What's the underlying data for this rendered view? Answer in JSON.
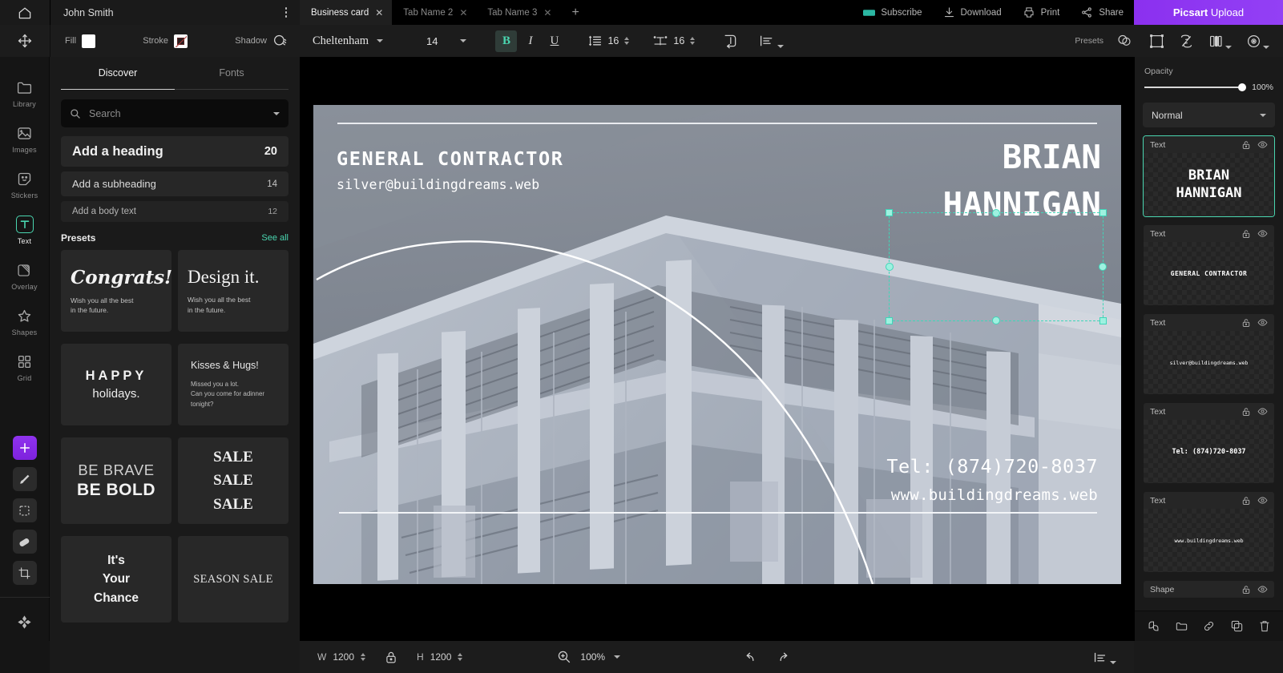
{
  "topbar": {
    "home_icon": "home-icon",
    "doc_title": "John Smith",
    "menu_icon": "kebab-menu-icon",
    "tabs": [
      {
        "label": "Business card",
        "active": true
      },
      {
        "label": "Tab Name 2",
        "active": false
      },
      {
        "label": "Tab Name 3",
        "active": false
      }
    ],
    "add_tab_label": "+",
    "actions": [
      {
        "label": "Subscribe",
        "icon": "subscribe-icon"
      },
      {
        "label": "Download",
        "icon": "download-icon"
      },
      {
        "label": "Print",
        "icon": "print-icon"
      },
      {
        "label": "Share",
        "icon": "share-icon"
      }
    ],
    "upload_brand": "Picsart",
    "upload_label": "Upload",
    "upload_color": "#8A2BE2"
  },
  "toolbar": {
    "move_icon": "move-icon",
    "fill_label": "Fill",
    "fill_color": "#ffffff",
    "stroke_label": "Stroke",
    "stroke_color": "#b03a3a",
    "shadow_label": "Shadow",
    "font_family": "Cheltenham",
    "font_size": "14",
    "bold_label": "B",
    "italic_label": "I",
    "underline_label": "U",
    "bold_active": true,
    "line_height": "16",
    "letter_spacing": "16",
    "curve_icon": "text-curve-icon",
    "align_icon": "text-align-icon",
    "presets_label": "Presets",
    "presets_icon": "presets-shape-icon",
    "right_icons": [
      "crop-frame-icon",
      "flip-icon",
      "duplicate-icon",
      "adjust-icon"
    ]
  },
  "rail": {
    "items": [
      {
        "label": "Library",
        "icon": "library-icon",
        "active": false
      },
      {
        "label": "Images",
        "icon": "images-icon",
        "active": false
      },
      {
        "label": "Stickers",
        "icon": "stickers-icon",
        "active": false
      },
      {
        "label": "Text",
        "icon": "text-icon",
        "active": true
      },
      {
        "label": "Overlay",
        "icon": "overlay-icon",
        "active": false
      },
      {
        "label": "Shapes",
        "icon": "shapes-star-icon",
        "active": false
      },
      {
        "label": "Grid",
        "icon": "grid-icon",
        "active": false
      }
    ],
    "bottom_tools": [
      {
        "icon": "add-plus-icon",
        "accent": true
      },
      {
        "icon": "brush-icon",
        "accent": false
      },
      {
        "icon": "selection-marquee-icon",
        "accent": false
      },
      {
        "icon": "eraser-icon",
        "accent": false
      },
      {
        "icon": "crop-icon",
        "accent": false
      },
      {
        "icon": "move-tool-icon",
        "accent": false
      }
    ]
  },
  "left_panel": {
    "tabs": [
      {
        "label": "Discover",
        "active": true
      },
      {
        "label": "Fonts",
        "active": false
      }
    ],
    "search": {
      "placeholder": "Search",
      "value": "",
      "icon": "search-icon",
      "chevron": "chevron-down-icon"
    },
    "add_items": [
      {
        "label": "Add a heading",
        "size": "20",
        "style": "h"
      },
      {
        "label": "Add a subheading",
        "size": "14",
        "style": "s"
      },
      {
        "label": "Add a body text",
        "size": "12",
        "style": "b"
      }
    ],
    "presets_title": "Presets",
    "see_all_label": "See all",
    "presets": [
      {
        "kind": "congrats",
        "title": "Congrats!",
        "body": "Wish you all the best\nin the future."
      },
      {
        "kind": "design",
        "title": "Design it.",
        "body": "Wish you all the best\nin the future."
      },
      {
        "kind": "happy",
        "title": "HAPPY",
        "sub": "holidays."
      },
      {
        "kind": "kisses",
        "title": "Kisses & Hugs!",
        "body": "Missed you a lot.\nCan you come for adinner\ntonight?"
      },
      {
        "kind": "brave",
        "title": "BE BRAVE",
        "sub": "BE BOLD"
      },
      {
        "kind": "sale",
        "lines": [
          "SALE",
          "SALE",
          "SALE"
        ]
      },
      {
        "kind": "its",
        "lines": [
          "It's",
          "Your",
          "Chance"
        ]
      },
      {
        "kind": "season",
        "title": "SEASON SALE"
      }
    ]
  },
  "canvas": {
    "card": {
      "general_contractor": "GENERAL  CONTRACTOR",
      "email": "silver@buildingdreams.web",
      "name_line1": "BRIAN",
      "name_line2": "HANNIGAN",
      "tel": "Tel:  (874)720-8037",
      "web": "www.buildingdreams.web"
    },
    "selection_color": "#3fd6b8"
  },
  "right_panel": {
    "opacity_label": "Opacity",
    "opacity_value": "100%",
    "blend_mode": "Normal",
    "layers": [
      {
        "type": "Text",
        "preview_line1": "BRIAN",
        "preview_line2": "HANNIGAN",
        "selected": true,
        "style": "name"
      },
      {
        "type": "Text",
        "preview_line1": "GENERAL  CONTRACTOR",
        "selected": false,
        "style": "gc"
      },
      {
        "type": "Text",
        "preview_line1": "silver@buildingdreams.web",
        "selected": false,
        "style": "mail"
      },
      {
        "type": "Text",
        "preview_line1": "Tel: (874)720-8037",
        "selected": false,
        "style": "tel"
      },
      {
        "type": "Text",
        "preview_line1": "www.buildingdreams.web",
        "selected": false,
        "style": "web"
      },
      {
        "type": "Shape",
        "preview_line1": "",
        "selected": false,
        "style": "shape"
      }
    ],
    "lock_icon": "lock-icon",
    "eye_icon": "eye-icon",
    "bottom_tools": [
      "merge-icon",
      "group-icon",
      "link-icon",
      "duplicate-layer-icon",
      "delete-icon"
    ]
  },
  "bottom_bar": {
    "width_label": "W",
    "width_value": "1200",
    "height_label": "H",
    "height_value": "1200",
    "lock_icon": "lock-aspect-icon",
    "zoom_icon": "zoom-in-icon",
    "zoom_value": "100%",
    "undo_icon": "undo-icon",
    "redo_icon": "redo-icon",
    "align_icon": "align-panel-icon"
  }
}
